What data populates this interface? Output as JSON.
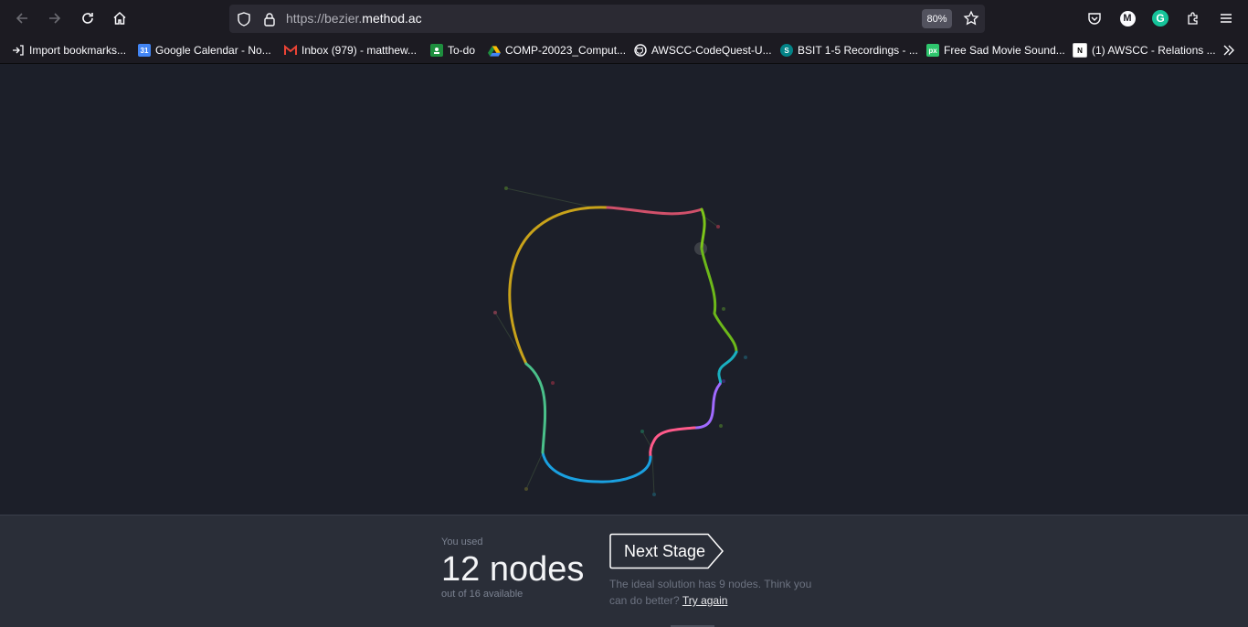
{
  "browser": {
    "url_prefix": "https://bezier.",
    "url_domain": "method.ac",
    "zoom": "80%",
    "icons": [
      "back-icon",
      "forward-icon",
      "reload-icon",
      "home-icon",
      "shield-icon",
      "lock-icon",
      "star-icon",
      "pocket-icon",
      "account-icon",
      "grammarly-icon",
      "extensions-icon",
      "menu-icon"
    ],
    "account_initial": "M",
    "grammarly_initial": "G"
  },
  "bookmarks": [
    {
      "label": "Import bookmarks...",
      "icon": "import-icon"
    },
    {
      "label": "Google Calendar - No...",
      "icon": "calendar-icon",
      "color": "#4285f4"
    },
    {
      "label": "Inbox (979) - matthew...",
      "icon": "gmail-icon",
      "color": "#ea4335"
    },
    {
      "label": "To-do",
      "icon": "classroom-icon",
      "color": "#1e8e3e"
    },
    {
      "label": "COMP-20023_Comput...",
      "icon": "drive-icon",
      "color": "#fbbc04"
    },
    {
      "label": "AWSCC-CodeQuest-U...",
      "icon": "github-icon",
      "color": "#ffffff"
    },
    {
      "label": "BSIT 1-5 Recordings - ...",
      "icon": "sharepoint-icon",
      "color": "#038387"
    },
    {
      "label": "Free Sad Movie Sound...",
      "icon": "pixabay-icon",
      "color": "#2ec66d"
    },
    {
      "label": "(1) AWSCC - Relations ...",
      "icon": "notion-icon",
      "color": "#ffffff"
    }
  ],
  "result": {
    "used_label": "You used",
    "nodes_text": "12 nodes",
    "available_text": "out of 16 available",
    "next_button": "Next Stage",
    "ideal_text": "The ideal solution has 9 nodes. Think you can do better?",
    "try_again": "Try again"
  },
  "colors": {
    "stage_bg": "#1c1f29",
    "panel_bg": "#2a2e38"
  }
}
